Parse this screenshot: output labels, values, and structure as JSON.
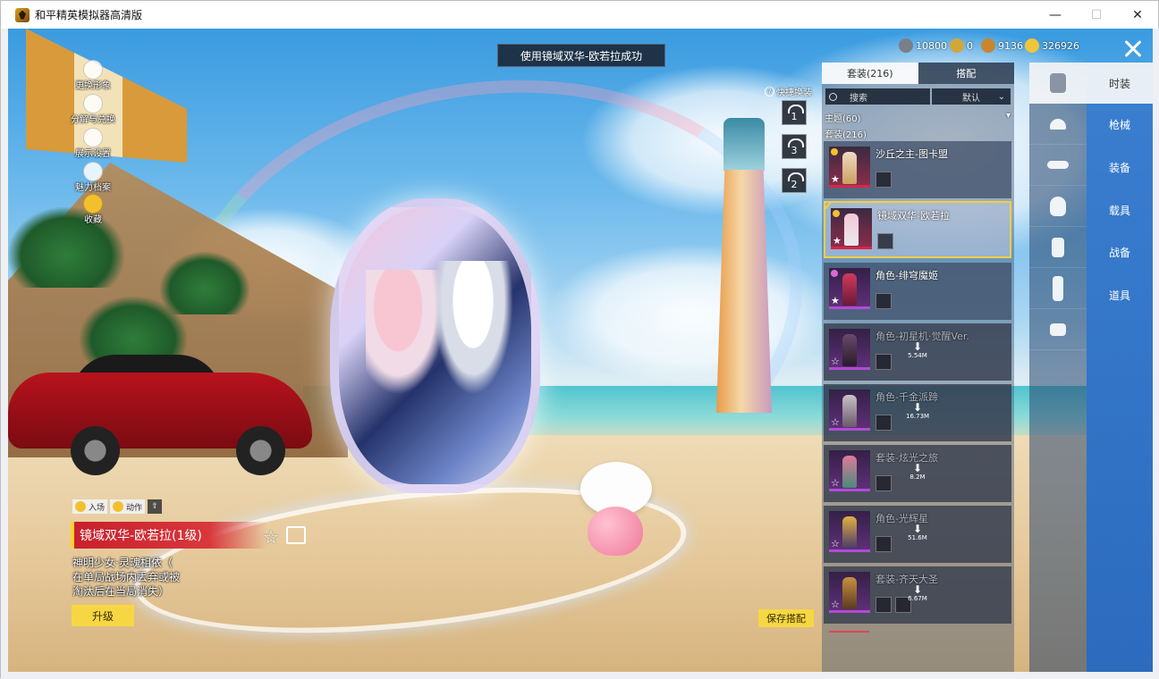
{
  "window": {
    "title": "和平精英模拟器高清版",
    "minimize": "—",
    "maximize": "☐",
    "close": "✕"
  },
  "toast": "使用镜域双华-欧若拉成功",
  "currencies": [
    {
      "icon": "gem-icon",
      "value": "10800",
      "color": "#7a7f8a"
    },
    {
      "icon": "token-icon",
      "value": "0",
      "color": "#d2a73a"
    },
    {
      "icon": "medal-icon",
      "value": "9136",
      "color": "#c8862e"
    },
    {
      "icon": "coin-icon",
      "value": "326926",
      "color": "#f0c53a"
    }
  ],
  "left_menu": [
    {
      "label": "更换形象",
      "icon": "person-icon"
    },
    {
      "label": "分解与兑换",
      "icon": "exchange-icon"
    },
    {
      "label": "展示设置",
      "icon": "eye-icon"
    },
    {
      "label": "魅力档案",
      "icon": "archive-icon"
    },
    {
      "label": "收藏",
      "icon": "collect-icon"
    }
  ],
  "quick_change": {
    "label": "快捷换装",
    "slots": [
      "1",
      "3",
      "2"
    ]
  },
  "character": {
    "action_buttons": [
      "入场",
      "动作",
      "⇧"
    ],
    "name": "镜域双华-欧若拉(1级)",
    "desc_lines": [
      "神明少女·灵魂相依（",
      "在单局战场内丢弃或被",
      "淘汰后在当局消失）"
    ],
    "upgrade": "升级"
  },
  "save_outfit": "保存搭配",
  "panel": {
    "tabs": [
      "套装(216)",
      "搭配"
    ],
    "search": "搜索",
    "sort": "默认",
    "theme_label": "主题(60)",
    "suit_label": "套装(216)",
    "items": [
      {
        "name": "沙丘之主-图卡盟",
        "rarity": "red",
        "state": "normal",
        "size": ""
      },
      {
        "name": "镜域双华-欧若拉",
        "rarity": "red",
        "state": "selected",
        "size": ""
      },
      {
        "name": "角色-绯穹魔姬",
        "rarity": "purple",
        "state": "normal",
        "size": ""
      },
      {
        "name": "角色-初星机·觉醒Ver.",
        "rarity": "purple",
        "state": "locked",
        "size": "5.54M"
      },
      {
        "name": "角色-千金派蹄",
        "rarity": "purple",
        "state": "locked",
        "size": "16.73M"
      },
      {
        "name": "套装-炫光之旅",
        "rarity": "purple",
        "state": "locked",
        "size": "8.2M"
      },
      {
        "name": "角色-光辉星",
        "rarity": "purple",
        "state": "locked",
        "size": "51.6M"
      },
      {
        "name": "套装-齐天大圣",
        "rarity": "purple",
        "state": "locked",
        "size": "6.67M"
      }
    ]
  },
  "categories": [
    "outfit-icon",
    "hat-icon",
    "glasses-icon",
    "mask-icon",
    "top-icon",
    "pants-icon",
    "shoes-icon"
  ],
  "right_nav": [
    "时装",
    "枪械",
    "装备",
    "载具",
    "战备",
    "道具"
  ]
}
